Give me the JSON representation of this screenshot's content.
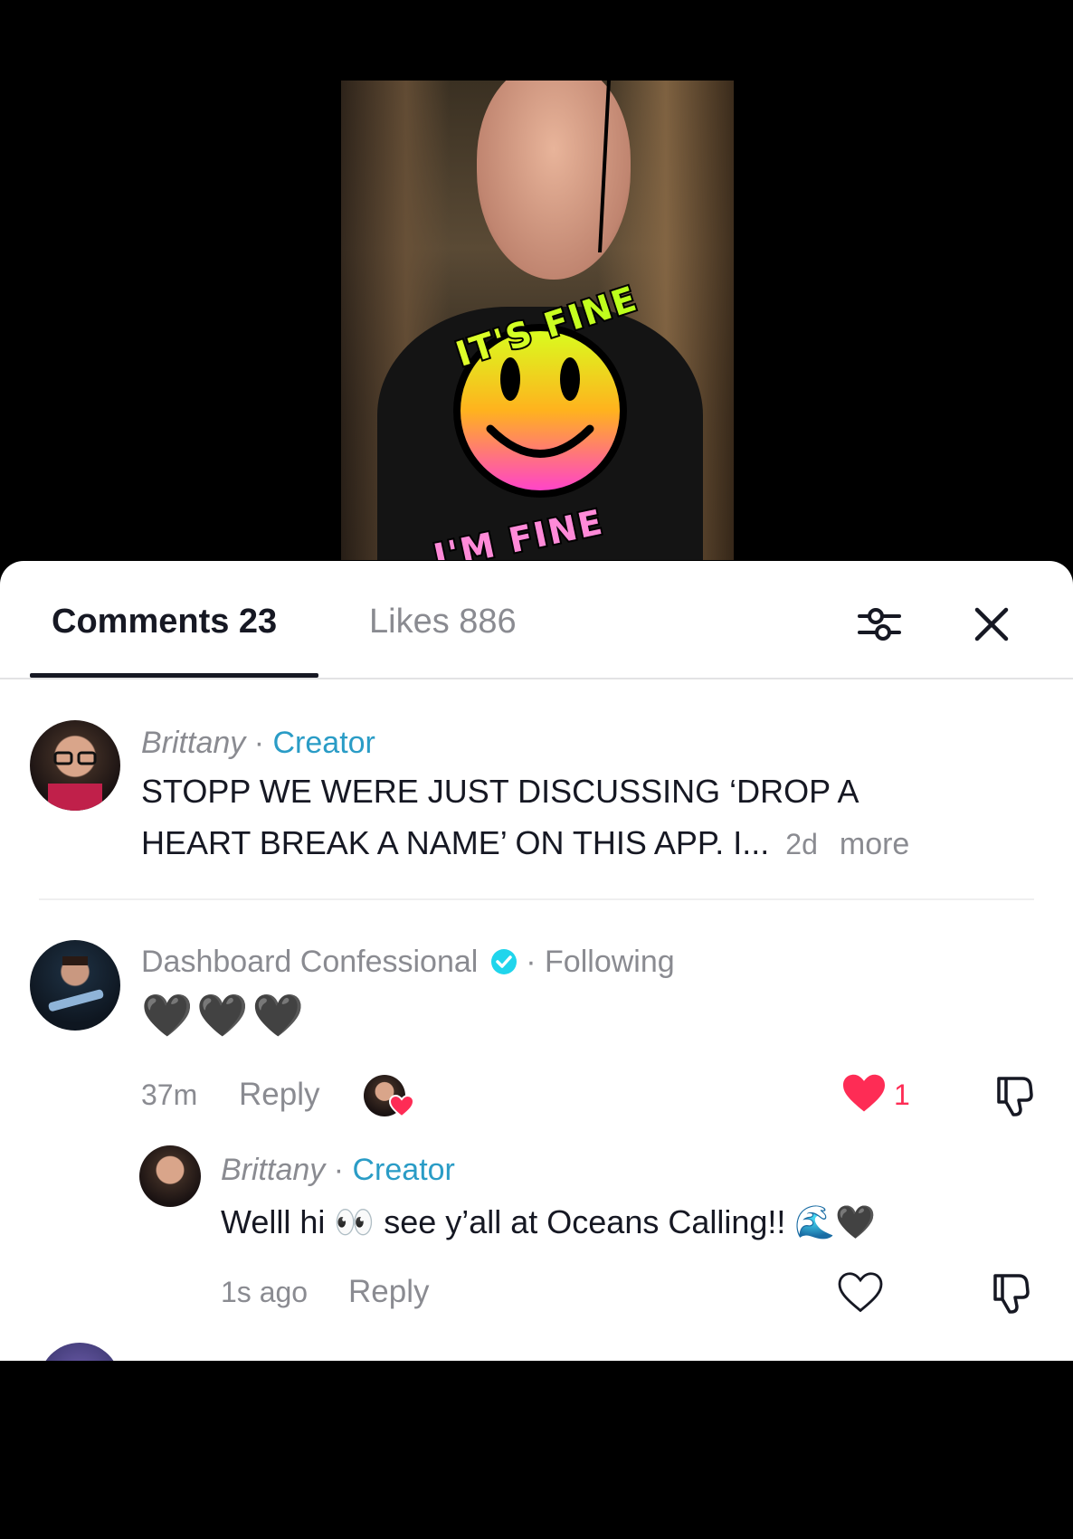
{
  "sticker": {
    "top_text": "IT'S FINE",
    "bottom_text": "I'M FINE"
  },
  "tabs": {
    "comments": "Comments 23",
    "likes": "Likes 886"
  },
  "comments": [
    {
      "author": "Brittany",
      "separator": "·",
      "badge": "Creator",
      "text_line1": "STOPP WE WERE JUST DISCUSSING ‘DROP A",
      "text_line2": "HEART BREAK A NAME’ ON THIS APP. I...",
      "time": "2d",
      "more": "more"
    },
    {
      "author": "Dashboard Confessional",
      "separator": "·",
      "badge": "Following",
      "text": "🖤🖤🖤",
      "time": "37m",
      "reply": "Reply",
      "like_count": "1"
    },
    {
      "author": "Brittany",
      "separator": "·",
      "badge": "Creator",
      "text": "Welll hi 👀 see y’all at Oceans Calling!! 🌊🖤",
      "time": "1s ago",
      "reply": "Reply"
    }
  ],
  "colors": {
    "accent": "#2a9cc6",
    "like": "#fe2c55",
    "verified": "#20d5ec"
  }
}
